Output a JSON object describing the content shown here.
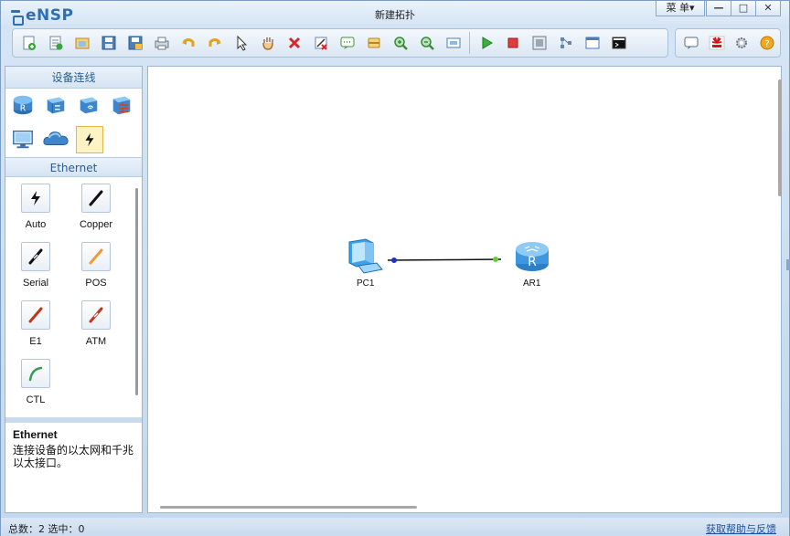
{
  "app": {
    "logo_text": "eNSP",
    "window_title": "新建拓扑",
    "menu_label": "菜 单▾",
    "minimize": "—",
    "maximize": "□",
    "close": "✕"
  },
  "toolbar": {
    "items": [
      "new-topology-icon",
      "new-exam-icon",
      "open-icon",
      "save-icon",
      "save-as-icon",
      "print-icon",
      "undo-icon",
      "redo-icon",
      "select-icon",
      "pan-hand-icon",
      "delete-icon",
      "delete-link-icon",
      "text-note-icon",
      "palette-icon",
      "zoom-in-icon",
      "zoom-out-icon",
      "fit-icon",
      "start-icon",
      "stop-icon",
      "capture-icon",
      "topology-icon",
      "display-icon",
      "cli-icon"
    ],
    "right_items": [
      "chat-icon",
      "huawei-logo-icon",
      "settings-gear-icon",
      "help-icon"
    ]
  },
  "left_panel": {
    "header": "设备连线",
    "devices": [
      "router-icon",
      "switch-icon",
      "wlan-icon",
      "firewall-icon",
      "pc-icon",
      "cloud-icon",
      "cable-icon"
    ],
    "subheader": "Ethernet",
    "cables": [
      {
        "label": "Auto",
        "icon": "auto-cable-icon"
      },
      {
        "label": "Copper",
        "icon": "copper-cable-icon"
      },
      {
        "label": "Serial",
        "icon": "serial-cable-icon"
      },
      {
        "label": "POS",
        "icon": "pos-cable-icon"
      },
      {
        "label": "E1",
        "icon": "e1-cable-icon"
      },
      {
        "label": "ATM",
        "icon": "atm-cable-icon"
      },
      {
        "label": "CTL",
        "icon": "ctl-cable-icon"
      }
    ],
    "desc_title": "Ethernet",
    "desc_text": "连接设备的以太网和千兆以太接口。"
  },
  "canvas": {
    "nodes": [
      {
        "label": "PC1",
        "icon": "pc-icon"
      },
      {
        "label": "AR1",
        "icon": "router-icon"
      }
    ]
  },
  "status": {
    "left": "总数：2 选中：0",
    "right": "获取帮助与反馈"
  },
  "colors": {
    "accent": "#2f6fb3",
    "link_end_blue": "#1a2fd6",
    "link_end_green": "#5fcf3a"
  }
}
